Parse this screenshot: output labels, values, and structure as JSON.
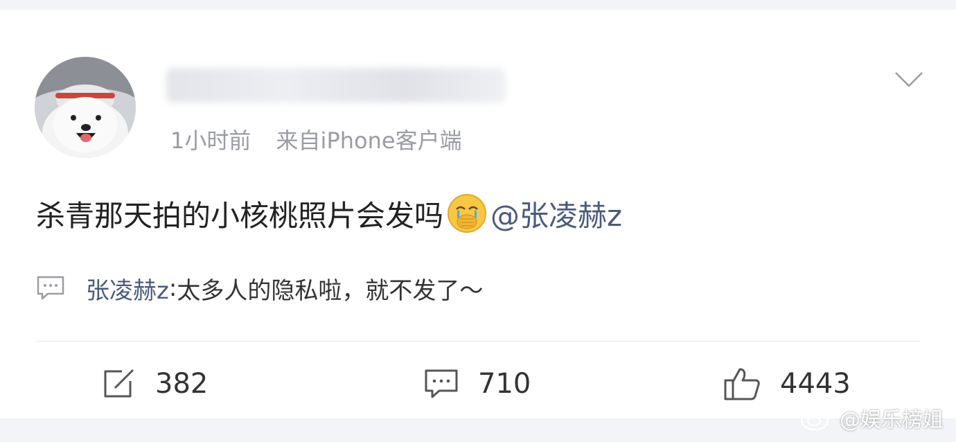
{
  "post": {
    "username": "",
    "time": "1小时前",
    "source": "来自iPhone客户端",
    "text": "杀青那天拍的小核桃照片会发吗",
    "emoji": "crying-emoji",
    "mention": "@张凌赫z"
  },
  "comment_preview": {
    "user": "张凌赫z",
    "separator": ": ",
    "text": "太多人的隐私啦，就不发了～"
  },
  "actions": {
    "repost_count": "382",
    "comment_count": "710",
    "like_count": "4443"
  },
  "watermark": {
    "text": "@娱乐榜姐"
  },
  "colors": {
    "mention": "#4a5a7f",
    "secondary_text": "#9a9ca3",
    "primary_text": "#222222"
  }
}
